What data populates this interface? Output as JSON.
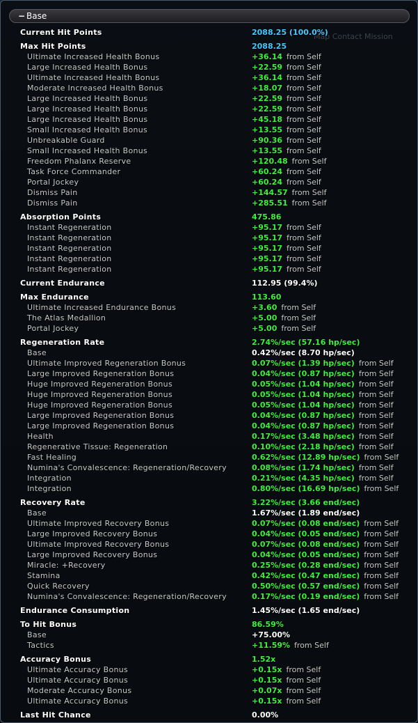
{
  "window": {
    "section_title": "Base",
    "collapse_glyph": "−",
    "background_text": "Map  Contact  Mission"
  },
  "rows": [
    {
      "type": "main",
      "label": "Current Hit Points",
      "value": "2088.25 (100.0%)",
      "color": "cyan",
      "src": ""
    },
    {
      "type": "gap"
    },
    {
      "type": "main",
      "label": "Max Hit Points",
      "value": "2088.25",
      "color": "cyan",
      "src": ""
    },
    {
      "type": "sub",
      "label": "Ultimate Increased Health Bonus",
      "value": "+36.14",
      "color": "green",
      "src": "from Self"
    },
    {
      "type": "sub",
      "label": "Large Increased Health Bonus",
      "value": "+22.59",
      "color": "green",
      "src": "from Self"
    },
    {
      "type": "sub",
      "label": "Ultimate Increased Health Bonus",
      "value": "+36.14",
      "color": "green",
      "src": "from Self"
    },
    {
      "type": "sub",
      "label": "Moderate Increased Health Bonus",
      "value": "+18.07",
      "color": "green",
      "src": "from Self"
    },
    {
      "type": "sub",
      "label": "Large Increased Health Bonus",
      "value": "+22.59",
      "color": "green",
      "src": "from Self"
    },
    {
      "type": "sub",
      "label": "Large Increased Health Bonus",
      "value": "+22.59",
      "color": "green",
      "src": "from Self"
    },
    {
      "type": "sub",
      "label": "Large Increased Health Bonus",
      "value": "+45.18",
      "color": "green",
      "src": "from Self"
    },
    {
      "type": "sub",
      "label": "Small Increased Health Bonus",
      "value": "+13.55",
      "color": "green",
      "src": "from Self"
    },
    {
      "type": "sub",
      "label": "Unbreakable Guard",
      "value": "+90.36",
      "color": "green",
      "src": "from Self"
    },
    {
      "type": "sub",
      "label": "Small Increased Health Bonus",
      "value": "+13.55",
      "color": "green",
      "src": "from Self"
    },
    {
      "type": "sub",
      "label": "Freedom Phalanx Reserve",
      "value": "+120.48",
      "color": "green",
      "src": "from Self"
    },
    {
      "type": "sub",
      "label": "Task Force Commander",
      "value": "+60.24",
      "color": "green",
      "src": "from Self"
    },
    {
      "type": "sub",
      "label": "Portal Jockey",
      "value": "+60.24",
      "color": "green",
      "src": "from Self"
    },
    {
      "type": "sub",
      "label": "Dismiss Pain",
      "value": "+144.57",
      "color": "green",
      "src": "from Self"
    },
    {
      "type": "sub",
      "label": "Dismiss Pain",
      "value": "+285.51",
      "color": "green",
      "src": "from Self"
    },
    {
      "type": "gap"
    },
    {
      "type": "main",
      "label": "Absorption Points",
      "value": "475.86",
      "color": "green",
      "src": ""
    },
    {
      "type": "sub",
      "label": "Instant Regeneration",
      "value": "+95.17",
      "color": "green",
      "src": "from Self"
    },
    {
      "type": "sub",
      "label": "Instant Regeneration",
      "value": "+95.17",
      "color": "green",
      "src": "from Self"
    },
    {
      "type": "sub",
      "label": "Instant Regeneration",
      "value": "+95.17",
      "color": "green",
      "src": "from Self"
    },
    {
      "type": "sub",
      "label": "Instant Regeneration",
      "value": "+95.17",
      "color": "green",
      "src": "from Self"
    },
    {
      "type": "sub",
      "label": "Instant Regeneration",
      "value": "+95.17",
      "color": "green",
      "src": "from Self"
    },
    {
      "type": "gap"
    },
    {
      "type": "main",
      "label": "Current Endurance",
      "value": "112.95 (99.4%)",
      "color": "white",
      "src": ""
    },
    {
      "type": "gap"
    },
    {
      "type": "main",
      "label": "Max Endurance",
      "value": "113.60",
      "color": "green",
      "src": ""
    },
    {
      "type": "sub",
      "label": "Ultimate Increased Endurance Bonus",
      "value": "+3.60",
      "color": "green",
      "src": "from Self"
    },
    {
      "type": "sub",
      "label": "The Atlas Medallion",
      "value": "+5.00",
      "color": "green",
      "src": "from Self"
    },
    {
      "type": "sub",
      "label": "Portal Jockey",
      "value": "+5.00",
      "color": "green",
      "src": "from Self"
    },
    {
      "type": "gap"
    },
    {
      "type": "main",
      "label": "Regeneration Rate",
      "value": "2.74%/sec  (57.16 hp/sec)",
      "color": "green",
      "src": ""
    },
    {
      "type": "sub",
      "label": "Base",
      "value": "0.42%/sec  (8.70 hp/sec)",
      "color": "white",
      "src": ""
    },
    {
      "type": "sub",
      "label": "Ultimate Improved Regeneration Bonus",
      "value": "0.07%/sec  (1.39 hp/sec)",
      "color": "green",
      "src": "from Self"
    },
    {
      "type": "sub",
      "label": "Large Improved Regeneration Bonus",
      "value": "0.04%/sec  (0.87 hp/sec)",
      "color": "green",
      "src": "from Self"
    },
    {
      "type": "sub",
      "label": "Huge Improved Regeneration Bonus",
      "value": "0.05%/sec  (1.04 hp/sec)",
      "color": "green",
      "src": "from Self"
    },
    {
      "type": "sub",
      "label": "Huge Improved Regeneration Bonus",
      "value": "0.05%/sec  (1.04 hp/sec)",
      "color": "green",
      "src": "from Self"
    },
    {
      "type": "sub",
      "label": "Huge Improved Regeneration Bonus",
      "value": "0.05%/sec  (1.04 hp/sec)",
      "color": "green",
      "src": "from Self"
    },
    {
      "type": "sub",
      "label": "Large Improved Regeneration Bonus",
      "value": "0.04%/sec  (0.87 hp/sec)",
      "color": "green",
      "src": "from Self"
    },
    {
      "type": "sub",
      "label": "Large Improved Regeneration Bonus",
      "value": "0.04%/sec  (0.87 hp/sec)",
      "color": "green",
      "src": "from Self"
    },
    {
      "type": "sub",
      "label": "Health",
      "value": "0.17%/sec  (3.48 hp/sec)",
      "color": "green",
      "src": "from Self"
    },
    {
      "type": "sub",
      "label": "Regenerative Tissue: Regeneration",
      "value": "0.10%/sec  (2.18 hp/sec)",
      "color": "green",
      "src": "from Self"
    },
    {
      "type": "sub",
      "label": "Fast Healing",
      "value": "0.62%/sec  (12.89 hp/sec)",
      "color": "green",
      "src": "from Self"
    },
    {
      "type": "sub",
      "label": "Numina's Convalescence: Regeneration/Recovery",
      "value": "0.08%/sec  (1.74 hp/sec)",
      "color": "green",
      "src": "from Self"
    },
    {
      "type": "sub",
      "label": "Integration",
      "value": "0.21%/sec  (4.35 hp/sec)",
      "color": "green",
      "src": "from Self"
    },
    {
      "type": "sub",
      "label": "Integration",
      "value": "0.80%/sec  (16.69 hp/sec)",
      "color": "green",
      "src": "from Self"
    },
    {
      "type": "gap"
    },
    {
      "type": "main",
      "label": "Recovery Rate",
      "value": "3.22%/sec  (3.66 end/sec)",
      "color": "green",
      "src": ""
    },
    {
      "type": "sub",
      "label": "Base",
      "value": "1.67%/sec  (1.89 end/sec)",
      "color": "white",
      "src": ""
    },
    {
      "type": "sub",
      "label": "Ultimate Improved Recovery Bonus",
      "value": "0.07%/sec  (0.08 end/sec)",
      "color": "green",
      "src": "from Self"
    },
    {
      "type": "sub",
      "label": "Large Improved Recovery Bonus",
      "value": "0.04%/sec  (0.05 end/sec)",
      "color": "green",
      "src": "from Self"
    },
    {
      "type": "sub",
      "label": "Ultimate Improved Recovery Bonus",
      "value": "0.07%/sec  (0.08 end/sec)",
      "color": "green",
      "src": "from Self"
    },
    {
      "type": "sub",
      "label": "Large Improved Recovery Bonus",
      "value": "0.04%/sec  (0.05 end/sec)",
      "color": "green",
      "src": "from Self"
    },
    {
      "type": "sub",
      "label": "Miracle: +Recovery",
      "value": "0.25%/sec  (0.28 end/sec)",
      "color": "green",
      "src": "from Self"
    },
    {
      "type": "sub",
      "label": "Stamina",
      "value": "0.42%/sec  (0.47 end/sec)",
      "color": "green",
      "src": "from Self"
    },
    {
      "type": "sub",
      "label": "Quick Recovery",
      "value": "0.50%/sec  (0.57 end/sec)",
      "color": "green",
      "src": "from Self"
    },
    {
      "type": "sub",
      "label": "Numina's Convalescence: Regeneration/Recovery",
      "value": "0.17%/sec  (0.19 end/sec)",
      "color": "green",
      "src": "from Self"
    },
    {
      "type": "gap"
    },
    {
      "type": "main",
      "label": "Endurance Consumption",
      "value": "1.45%/sec  (1.65 end/sec)",
      "color": "white",
      "src": ""
    },
    {
      "type": "gap"
    },
    {
      "type": "main",
      "label": "To Hit Bonus",
      "value": "86.59%",
      "color": "green",
      "src": ""
    },
    {
      "type": "sub",
      "label": "Base",
      "value": "+75.00%",
      "color": "white",
      "src": ""
    },
    {
      "type": "sub",
      "label": "Tactics",
      "value": "+11.59%",
      "color": "green",
      "src": "from Self"
    },
    {
      "type": "gap"
    },
    {
      "type": "main",
      "label": "Accuracy Bonus",
      "value": "1.52x",
      "color": "green",
      "src": ""
    },
    {
      "type": "sub",
      "label": "Ultimate Accuracy Bonus",
      "value": "+0.15x",
      "color": "green",
      "src": "from Self"
    },
    {
      "type": "sub",
      "label": "Ultimate Accuracy Bonus",
      "value": "+0.15x",
      "color": "green",
      "src": "from Self"
    },
    {
      "type": "sub",
      "label": "Moderate Accuracy Bonus",
      "value": "+0.07x",
      "color": "green",
      "src": "from Self"
    },
    {
      "type": "sub",
      "label": "Ultimate Accuracy Bonus",
      "value": "+0.15x",
      "color": "green",
      "src": "from Self"
    },
    {
      "type": "gap"
    },
    {
      "type": "main",
      "label": "Last Hit Chance",
      "value": "0.00%",
      "color": "white",
      "src": ""
    }
  ]
}
